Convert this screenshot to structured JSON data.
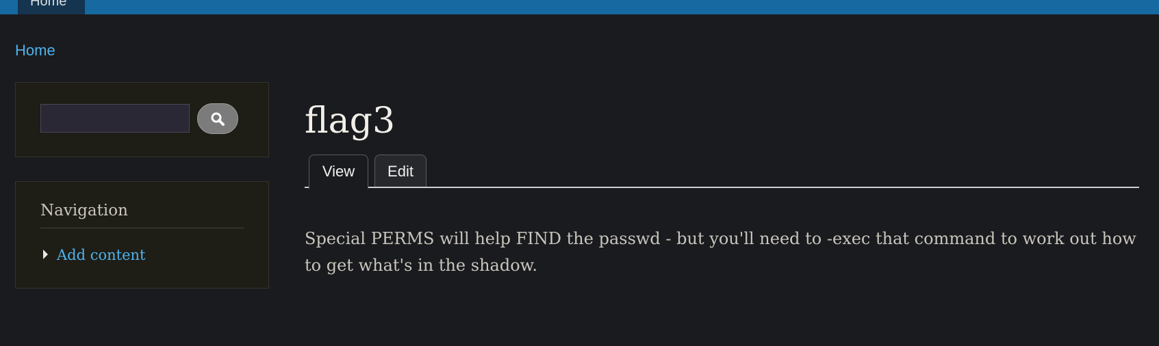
{
  "topbar": {
    "tab_label": "Home"
  },
  "breadcrumb": {
    "home": "Home"
  },
  "search": {
    "value": "",
    "placeholder": ""
  },
  "navigation": {
    "title": "Navigation",
    "items": [
      {
        "label": "Add content"
      }
    ]
  },
  "page": {
    "title": "flag3",
    "tabs": [
      {
        "label": "View",
        "active": true
      },
      {
        "label": "Edit",
        "active": false
      }
    ],
    "body": "Special PERMS will help FIND the passwd - but you'll need to -exec that command to work out how to get what's in the shadow."
  },
  "colors": {
    "topbar": "#1669a1",
    "background": "#1a1b1e",
    "link": "#4fb3ee",
    "block": "#1e1d16"
  },
  "icons": {
    "search_button": "search-icon",
    "nav_bullet": "triangle-right-icon"
  }
}
